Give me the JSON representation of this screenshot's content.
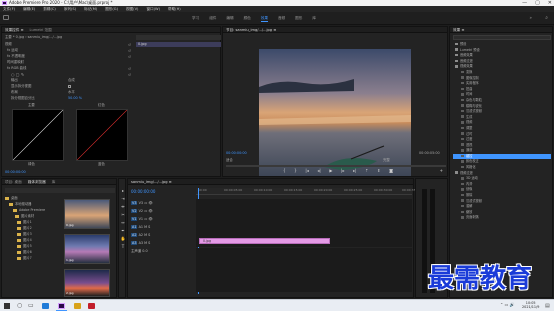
{
  "window": {
    "title": "Adobe Premiere Pro 2020 - C:\\用户\\Mac\\桌面.prproj *",
    "controls": [
      "—",
      "▢",
      "✕"
    ]
  },
  "menu": [
    "文件(F)",
    "编辑(E)",
    "剪辑(C)",
    "序列(S)",
    "标记(M)",
    "图形(G)",
    "视图(V)",
    "窗口(W)",
    "帮助(H)"
  ],
  "workspaces": {
    "tabs": [
      "学习",
      "组件",
      "编辑",
      "颜色",
      "效果",
      "音频",
      "图形",
      "库"
    ],
    "active_index": 4
  },
  "effect_controls": {
    "tabs": [
      "效果控件 ≡",
      "Lumetri 范围"
    ],
    "source_line": "主要 * 0.jpg  ›  sanmiu_img/.../...jpg",
    "track_clip": "0.jpg",
    "rows": [
      {
        "label": "视频",
        "value": ""
      },
      {
        "label": "fx 运动",
        "value": ""
      },
      {
        "label": "fx 不透明度",
        "value": ""
      },
      {
        "label": "时间重映射",
        "value": ""
      },
      {
        "label": "fx RGB 曲线",
        "value": ""
      },
      {
        "label": "",
        "value": ""
      },
      {
        "label": "输出",
        "value": "合成"
      },
      {
        "label": "显示拆分视图",
        "value": ""
      },
      {
        "label": "布局",
        "value": "水平"
      },
      {
        "label": "拆分视图百分比",
        "value": "50.00 %"
      }
    ],
    "graph_labels": [
      "主要",
      "红色",
      "绿色",
      "蓝色"
    ],
    "timecode": "00:00:00:00"
  },
  "program_monitor": {
    "title": "节目: sanmiu_img/.../...jpg ≡",
    "timecode_left": "00:00:00:00",
    "fit": "适合",
    "quality": "完整",
    "timecode_right": "00:00:05:00"
  },
  "project": {
    "tabs": [
      "项目: 桌面",
      "媒体浏览器",
      "库",
      "信息",
      "效果",
      "标记"
    ],
    "tree": [
      "桌面",
      "本地驱动器",
      "Adobe Premiere",
      "图片素材",
      "图片1",
      "图片2",
      "图片3",
      "图片4",
      "图片5",
      "图片6",
      "图片7"
    ],
    "thumbs": [
      "0.jpg",
      "1.jpg",
      "2.jpg"
    ]
  },
  "timeline": {
    "sequence_tab": "sanmiu_img/.../...jpg ≡",
    "timecode": "00:00:00:00",
    "tracks": [
      "V3",
      "V2",
      "V1",
      "A1",
      "A2",
      "A3"
    ],
    "master": "主声道",
    "master_value": "0.0",
    "clip_label": "0.jpg",
    "ruler": [
      "00:00",
      "00:00:05:00",
      "00:00:10:00",
      "00:00:15:00",
      "00:00:20:00",
      "00:00:25:00",
      "00:00:30:00",
      "00:00:35:00"
    ]
  },
  "effects": {
    "title": "效果 ≡",
    "items": [
      {
        "t": "预设",
        "l": 1
      },
      {
        "t": "Lumetri 预设",
        "l": 1
      },
      {
        "t": "音频效果",
        "l": 1
      },
      {
        "t": "音频过渡",
        "l": 1
      },
      {
        "t": "视频效果",
        "l": 1
      },
      {
        "t": "变换",
        "l": 2
      },
      {
        "t": "图像控制",
        "l": 2
      },
      {
        "t": "实用程序",
        "l": 2
      },
      {
        "t": "扭曲",
        "l": 2
      },
      {
        "t": "时间",
        "l": 2
      },
      {
        "t": "杂色与颗粒",
        "l": 2
      },
      {
        "t": "模糊与锐化",
        "l": 2
      },
      {
        "t": "沉浸式视频",
        "l": 2
      },
      {
        "t": "生成",
        "l": 2
      },
      {
        "t": "视频",
        "l": 2
      },
      {
        "t": "调整",
        "l": 2
      },
      {
        "t": "过时",
        "l": 2
      },
      {
        "t": "过渡",
        "l": 2
      },
      {
        "t": "透视",
        "l": 2
      },
      {
        "t": "通道",
        "l": 2
      },
      {
        "t": "键控",
        "l": 2
      },
      {
        "t": "颜色校正",
        "l": 2
      },
      {
        "t": "风格化",
        "l": 2
      },
      {
        "t": "视频过渡",
        "l": 1
      },
      {
        "t": "3D 运动",
        "l": 2
      },
      {
        "t": "内滑",
        "l": 2
      },
      {
        "t": "划像",
        "l": 2
      },
      {
        "t": "擦除",
        "l": 2
      },
      {
        "t": "沉浸式视频",
        "l": 2
      },
      {
        "t": "溶解",
        "l": 2
      },
      {
        "t": "缩放",
        "l": 2
      },
      {
        "t": "页面剥落",
        "l": 2
      }
    ],
    "highlight_index": 20
  },
  "watermark": "最需教育",
  "taskbar": {
    "time": "10:05",
    "date": "2021/11/9"
  },
  "colors": {
    "accent": "#3f95ff",
    "clip": "#e49ae6",
    "panel": "#232323"
  }
}
